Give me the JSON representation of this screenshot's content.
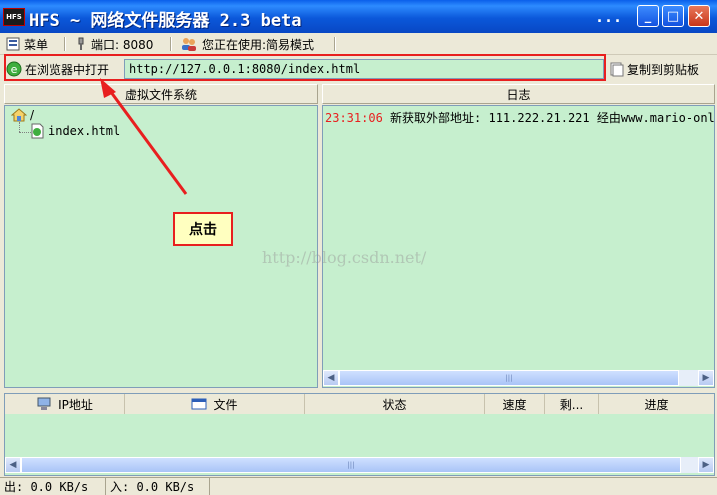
{
  "window": {
    "logo_text": "HFS",
    "title": "HFS ~ 网络文件服务器 2.3 beta",
    "title_dots": "...",
    "minimize_symbol": "_",
    "maximize_symbol": "□",
    "close_symbol": "✕"
  },
  "menubar": {
    "menu_label": "菜单",
    "port_label": "端口: 8080",
    "mode_label": "您正在使用:简易模式"
  },
  "urlbar": {
    "open_in_browser_label": "在浏览器中打开",
    "url_value": "http://127.0.0.1:8080/index.html",
    "copy_clipboard_label": "复制到剪贴板"
  },
  "vfs": {
    "header": "虚拟文件系统",
    "root_label": "/",
    "files": [
      "index.html"
    ]
  },
  "log": {
    "header": "日志",
    "entries": [
      {
        "time": "23:31:06",
        "message": "新获取外部地址: 111.222.21.221 经由www.mario-onl"
      }
    ]
  },
  "connections": {
    "columns": [
      "IP地址",
      "文件",
      "状态",
      "速度",
      "剩...",
      "进度"
    ]
  },
  "statusbar": {
    "out_label": "出: 0.0 KB/s",
    "in_label": "入: 0.0 KB/s"
  },
  "annotation": {
    "callout_text": "点击",
    "watermark": "http://blog.csdn.net/",
    "highlight_color": "#E81F1F"
  },
  "colors": {
    "list_background": "#C6EFCE",
    "window_face": "#ECE9D8",
    "titlebar_blue": "#0A5FEA",
    "log_time_color": "#E81F1F"
  }
}
